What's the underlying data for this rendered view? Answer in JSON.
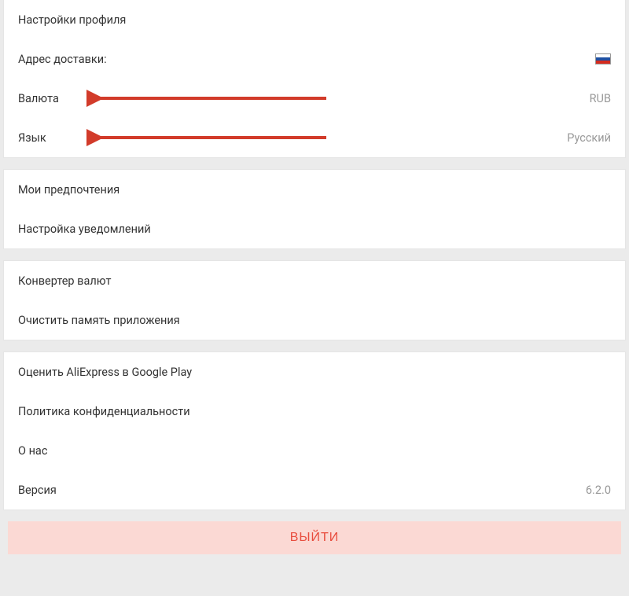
{
  "section1": {
    "profile_settings": "Настройки профиля",
    "shipping_address_label": "Адрес доставки:",
    "currency_label": "Валюта",
    "currency_value": "RUB",
    "language_label": "Язык",
    "language_value": "Русский"
  },
  "section2": {
    "my_preferences": "Мои предпочтения",
    "notification_settings": "Настройка уведомлений"
  },
  "section3": {
    "currency_converter": "Конвертер валют",
    "clear_app_memory": "Очистить память приложения"
  },
  "section4": {
    "rate_app": "Оценить AliExpress в Google Play",
    "privacy_policy": "Политика конфиденциальности",
    "about_us": "О нас",
    "version_label": "Версия",
    "version_value": "6.2.0"
  },
  "logout_label": "ВЫЙТИ"
}
